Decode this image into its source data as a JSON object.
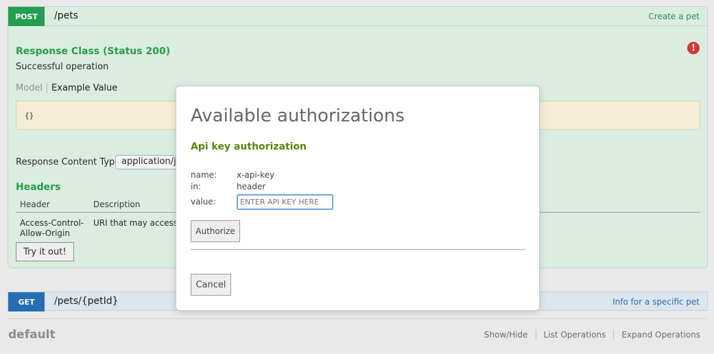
{
  "post_op": {
    "method": "POST",
    "path": "/pets",
    "summary": "Create a pet",
    "response_class": "Response Class (Status 200)",
    "success_text": "Successful operation",
    "error_icon": "!",
    "model_tab": "Model",
    "example_tab": "Example Value",
    "example_value": "{}",
    "response_content_type_label": "Response Content Type",
    "response_content_type_value": "application/js",
    "headers_title": "Headers",
    "headers_columns": [
      "Header",
      "Description"
    ],
    "headers_rows": [
      {
        "header": "Access-Control-Allow-Origin",
        "header_line1": "Access-Control-",
        "header_line2": "Allow-Origin",
        "description": "URI that may access th"
      }
    ],
    "try_button": "Try it out!"
  },
  "get_op": {
    "method": "GET",
    "path": "/pets/{petId}",
    "summary": "Info for a specific pet"
  },
  "default_section": {
    "title": "default",
    "links": [
      "Show/Hide",
      "List Operations",
      "Expand Operations"
    ]
  },
  "modal": {
    "title": "Available authorizations",
    "auth_title": "Api key authorization",
    "name_label": "name:",
    "name_value": "x-api-key",
    "in_label": "in:",
    "in_value": "header",
    "value_label": "value:",
    "value_placeholder": "ENTER API KEY HERE",
    "authorize_button": "Authorize",
    "cancel_button": "Cancel"
  },
  "colors": {
    "post": "#1c9c4a",
    "get": "#1e68b0",
    "auth_title": "#58860f",
    "error": "#d32f2f"
  }
}
